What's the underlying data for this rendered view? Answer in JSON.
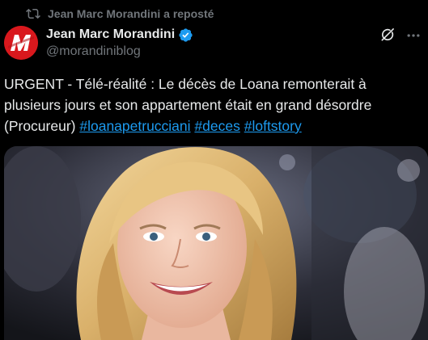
{
  "repost": {
    "icon": "repost-icon",
    "label": "Jean Marc Morandini a reposté"
  },
  "author": {
    "avatar_icon": "morandini-logo",
    "avatar_color": "#d9181d",
    "display_name": "Jean Marc Morandini",
    "verified_icon": "verified-badge-icon",
    "verified_color": "#1d9bf0",
    "handle": "@morandiniblog"
  },
  "actions": {
    "grok_icon": "grok-icon",
    "more_icon": "more-options-icon"
  },
  "tweet": {
    "text_plain": "URGENT - Télé-réalité : Le décès de Loana remonterait à plusieurs jours et son appartement était en grand désordre (Procureur) ",
    "hashtags": [
      "#loanapetrucciani",
      "#deces",
      "#loftstory"
    ],
    "hashtag_color": "#1d9bf0"
  },
  "media": {
    "type": "photo"
  }
}
